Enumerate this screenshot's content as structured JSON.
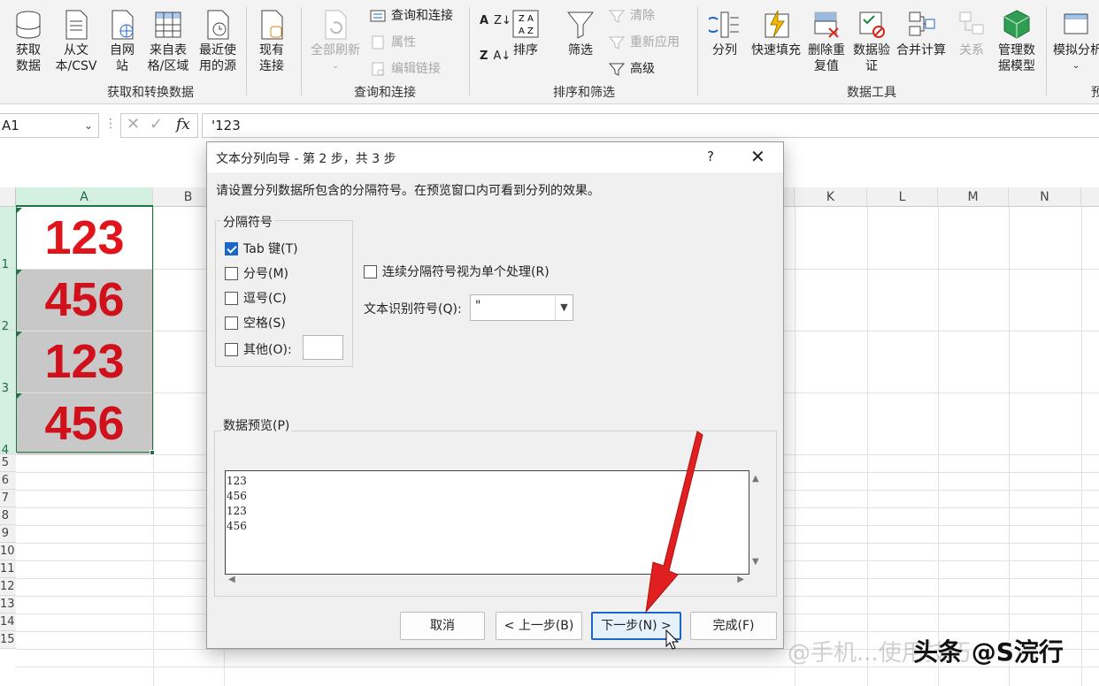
{
  "ribbon": {
    "get_data": "获取数据",
    "from_text": "从文本/CSV",
    "from_web": "自网站",
    "from_table": "来自表格/区域",
    "recent_sources": "最近使用的源",
    "existing_conn": "现有连接",
    "refresh_all": "全部刷新",
    "queries_conn": "查询和连接",
    "properties": "属性",
    "edit_links": "编辑链接",
    "sort": "排序",
    "filter": "筛选",
    "clear": "清除",
    "reapply": "重新应用",
    "advanced": "高级",
    "text_to_columns": "分列",
    "flash_fill": "快速填充",
    "remove_dup": "删除重复值",
    "data_validation": "数据验证",
    "consolidate": "合并计算",
    "relationships": "关系",
    "data_model": "管理数据模型",
    "whatif": "模拟分析",
    "group_get": "获取和转换数据",
    "group_query": "查询和连接",
    "group_sort": "排序和筛选",
    "group_tools": "数据工具",
    "group_forecast": "预"
  },
  "formula_bar": {
    "name_box": "A1",
    "fx": "fx",
    "content": "'123"
  },
  "sheet": {
    "columns": [
      "A",
      "B",
      "K",
      "L",
      "M",
      "N"
    ],
    "rows": [
      "1",
      "2",
      "3",
      "4",
      "5",
      "6",
      "7",
      "8",
      "9",
      "10",
      "11",
      "12",
      "13",
      "14",
      "15"
    ],
    "cells": [
      "123",
      "456",
      "123",
      "456"
    ]
  },
  "dialog": {
    "title": "文本分列向导 - 第 2 步，共 3 步",
    "help": "?",
    "close": "✕",
    "instruction": "请设置分列数据所包含的分隔符号。在预览窗口内可看到分列的效果。",
    "delimiters_legend": "分隔符号",
    "tab": "Tab 键(T)",
    "semicolon": "分号(M)",
    "comma": "逗号(C)",
    "space": "空格(S)",
    "other": "其他(O):",
    "consecutive": "连续分隔符号视为单个处理(R)",
    "qualifier_label": "文本识别符号(Q):",
    "qualifier_value": "\"",
    "preview_legend": "数据预览(P)",
    "preview_lines": [
      "123",
      "456",
      "123",
      "456"
    ],
    "cancel": "取消",
    "back": "< 上一步(B)",
    "next": "下一步(N) >",
    "finish": "完成(F)"
  },
  "watermark": "头条 @S浣行",
  "watermark_faint": "@手机...使用技巧",
  "colors": {
    "accent": "#1a66c9",
    "excel_green": "#217346",
    "cell_red": "#e0151c",
    "arrow_red": "#e02020"
  }
}
